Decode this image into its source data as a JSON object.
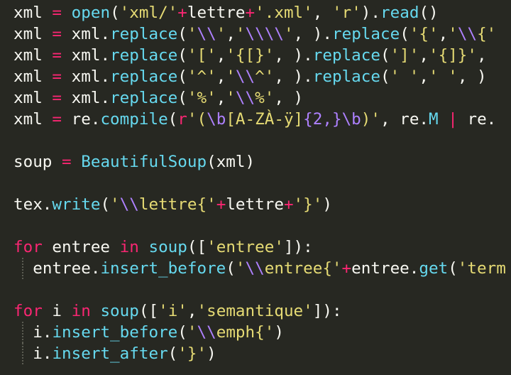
{
  "colors": {
    "background": "#272822",
    "plain": "#f8f8f2",
    "keyword": "#f92672",
    "builtin": "#66d9ef",
    "method": "#66d9ef",
    "string": "#e6db74",
    "escape": "#ae81ff",
    "indent_guide": "#5b5c52"
  },
  "lines": [
    {
      "indent": 0,
      "tokens": [
        {
          "t": "xml",
          "c": "plain"
        },
        {
          "t": " ",
          "c": "plain"
        },
        {
          "t": "=",
          "c": "keyword"
        },
        {
          "t": " ",
          "c": "plain"
        },
        {
          "t": "open",
          "c": "builtin"
        },
        {
          "t": "(",
          "c": "plain"
        },
        {
          "t": "'xml/'",
          "c": "string"
        },
        {
          "t": "+",
          "c": "keyword"
        },
        {
          "t": "lettre",
          "c": "plain"
        },
        {
          "t": "+",
          "c": "keyword"
        },
        {
          "t": "'.xml'",
          "c": "string"
        },
        {
          "t": ", ",
          "c": "plain"
        },
        {
          "t": "'r'",
          "c": "string"
        },
        {
          "t": ").",
          "c": "plain"
        },
        {
          "t": "read",
          "c": "method"
        },
        {
          "t": "()",
          "c": "plain"
        }
      ]
    },
    {
      "indent": 0,
      "tokens": [
        {
          "t": "xml",
          "c": "plain"
        },
        {
          "t": " ",
          "c": "plain"
        },
        {
          "t": "=",
          "c": "keyword"
        },
        {
          "t": " xml.",
          "c": "plain"
        },
        {
          "t": "replace",
          "c": "method"
        },
        {
          "t": "(",
          "c": "plain"
        },
        {
          "t": "'",
          "c": "string"
        },
        {
          "t": "\\\\",
          "c": "escape"
        },
        {
          "t": "'",
          "c": "string"
        },
        {
          "t": ",",
          "c": "plain"
        },
        {
          "t": "'",
          "c": "string"
        },
        {
          "t": "\\\\\\\\",
          "c": "escape"
        },
        {
          "t": "'",
          "c": "string"
        },
        {
          "t": ", ).",
          "c": "plain"
        },
        {
          "t": "replace",
          "c": "method"
        },
        {
          "t": "(",
          "c": "plain"
        },
        {
          "t": "'{'",
          "c": "string"
        },
        {
          "t": ",",
          "c": "plain"
        },
        {
          "t": "'",
          "c": "string"
        },
        {
          "t": "\\\\",
          "c": "escape"
        },
        {
          "t": "{'",
          "c": "string"
        }
      ]
    },
    {
      "indent": 0,
      "tokens": [
        {
          "t": "xml",
          "c": "plain"
        },
        {
          "t": " ",
          "c": "plain"
        },
        {
          "t": "=",
          "c": "keyword"
        },
        {
          "t": " xml.",
          "c": "plain"
        },
        {
          "t": "replace",
          "c": "method"
        },
        {
          "t": "(",
          "c": "plain"
        },
        {
          "t": "'['",
          "c": "string"
        },
        {
          "t": ",",
          "c": "plain"
        },
        {
          "t": "'{[}'",
          "c": "string"
        },
        {
          "t": ", ).",
          "c": "plain"
        },
        {
          "t": "replace",
          "c": "method"
        },
        {
          "t": "(",
          "c": "plain"
        },
        {
          "t": "']'",
          "c": "string"
        },
        {
          "t": ",",
          "c": "plain"
        },
        {
          "t": "'{]}'",
          "c": "string"
        },
        {
          "t": ", ",
          "c": "plain"
        }
      ]
    },
    {
      "indent": 0,
      "tokens": [
        {
          "t": "xml",
          "c": "plain"
        },
        {
          "t": " ",
          "c": "plain"
        },
        {
          "t": "=",
          "c": "keyword"
        },
        {
          "t": " xml.",
          "c": "plain"
        },
        {
          "t": "replace",
          "c": "method"
        },
        {
          "t": "(",
          "c": "plain"
        },
        {
          "t": "'^'",
          "c": "string"
        },
        {
          "t": ",",
          "c": "plain"
        },
        {
          "t": "'",
          "c": "string"
        },
        {
          "t": "\\\\",
          "c": "escape"
        },
        {
          "t": "^'",
          "c": "string"
        },
        {
          "t": ", ).",
          "c": "plain"
        },
        {
          "t": "replace",
          "c": "method"
        },
        {
          "t": "(",
          "c": "plain"
        },
        {
          "t": "' '",
          "c": "string"
        },
        {
          "t": ",",
          "c": "plain"
        },
        {
          "t": "' '",
          "c": "string"
        },
        {
          "t": ", )",
          "c": "plain"
        }
      ]
    },
    {
      "indent": 0,
      "tokens": [
        {
          "t": "xml",
          "c": "plain"
        },
        {
          "t": " ",
          "c": "plain"
        },
        {
          "t": "=",
          "c": "keyword"
        },
        {
          "t": " xml.",
          "c": "plain"
        },
        {
          "t": "replace",
          "c": "method"
        },
        {
          "t": "(",
          "c": "plain"
        },
        {
          "t": "'%'",
          "c": "string"
        },
        {
          "t": ",",
          "c": "plain"
        },
        {
          "t": "'",
          "c": "string"
        },
        {
          "t": "\\\\",
          "c": "escape"
        },
        {
          "t": "%'",
          "c": "string"
        },
        {
          "t": ", )",
          "c": "plain"
        }
      ]
    },
    {
      "indent": 0,
      "tokens": [
        {
          "t": "xml",
          "c": "plain"
        },
        {
          "t": " ",
          "c": "plain"
        },
        {
          "t": "=",
          "c": "keyword"
        },
        {
          "t": " re.",
          "c": "plain"
        },
        {
          "t": "compile",
          "c": "method"
        },
        {
          "t": "(",
          "c": "plain"
        },
        {
          "t": "r",
          "c": "keyword"
        },
        {
          "t": "'(",
          "c": "string"
        },
        {
          "t": "\\b",
          "c": "escape"
        },
        {
          "t": "[A-ZÀ-ÿ]",
          "c": "string"
        },
        {
          "t": "{2,}",
          "c": "escape"
        },
        {
          "t": "\\b",
          "c": "escape"
        },
        {
          "t": ")'",
          "c": "string"
        },
        {
          "t": ", re.",
          "c": "plain"
        },
        {
          "t": "M",
          "c": "builtin"
        },
        {
          "t": " ",
          "c": "plain"
        },
        {
          "t": "|",
          "c": "keyword"
        },
        {
          "t": " re.",
          "c": "plain"
        }
      ]
    },
    {
      "indent": 0,
      "tokens": []
    },
    {
      "indent": 0,
      "tokens": [
        {
          "t": "soup",
          "c": "plain"
        },
        {
          "t": " ",
          "c": "plain"
        },
        {
          "t": "=",
          "c": "keyword"
        },
        {
          "t": " ",
          "c": "plain"
        },
        {
          "t": "BeautifulSoup",
          "c": "method"
        },
        {
          "t": "(xml)",
          "c": "plain"
        }
      ]
    },
    {
      "indent": 0,
      "tokens": []
    },
    {
      "indent": 0,
      "tokens": [
        {
          "t": "tex.",
          "c": "plain"
        },
        {
          "t": "write",
          "c": "method"
        },
        {
          "t": "(",
          "c": "plain"
        },
        {
          "t": "'",
          "c": "string"
        },
        {
          "t": "\\\\",
          "c": "escape"
        },
        {
          "t": "lettre{'",
          "c": "string"
        },
        {
          "t": "+",
          "c": "keyword"
        },
        {
          "t": "lettre",
          "c": "plain"
        },
        {
          "t": "+",
          "c": "keyword"
        },
        {
          "t": "'}'",
          "c": "string"
        },
        {
          "t": ")",
          "c": "plain"
        }
      ]
    },
    {
      "indent": 0,
      "tokens": []
    },
    {
      "indent": 0,
      "tokens": [
        {
          "t": "for",
          "c": "keyword"
        },
        {
          "t": " entree ",
          "c": "plain"
        },
        {
          "t": "in",
          "c": "keyword"
        },
        {
          "t": " ",
          "c": "plain"
        },
        {
          "t": "soup",
          "c": "method"
        },
        {
          "t": "([",
          "c": "plain"
        },
        {
          "t": "'entree'",
          "c": "string"
        },
        {
          "t": "]):",
          "c": "plain"
        }
      ]
    },
    {
      "indent": 1,
      "tokens": [
        {
          "t": "  ",
          "c": "plain"
        },
        {
          "t": "entree.",
          "c": "plain"
        },
        {
          "t": "insert_before",
          "c": "method"
        },
        {
          "t": "(",
          "c": "plain"
        },
        {
          "t": "'",
          "c": "string"
        },
        {
          "t": "\\\\",
          "c": "escape"
        },
        {
          "t": "entree{'",
          "c": "string"
        },
        {
          "t": "+",
          "c": "keyword"
        },
        {
          "t": "entree.",
          "c": "plain"
        },
        {
          "t": "get",
          "c": "method"
        },
        {
          "t": "(",
          "c": "plain"
        },
        {
          "t": "'term",
          "c": "string"
        }
      ]
    },
    {
      "indent": 0,
      "tokens": []
    },
    {
      "indent": 0,
      "tokens": [
        {
          "t": "for",
          "c": "keyword"
        },
        {
          "t": " i ",
          "c": "plain"
        },
        {
          "t": "in",
          "c": "keyword"
        },
        {
          "t": " ",
          "c": "plain"
        },
        {
          "t": "soup",
          "c": "method"
        },
        {
          "t": "([",
          "c": "plain"
        },
        {
          "t": "'i'",
          "c": "string"
        },
        {
          "t": ",",
          "c": "plain"
        },
        {
          "t": "'semantique'",
          "c": "string"
        },
        {
          "t": "]):",
          "c": "plain"
        }
      ]
    },
    {
      "indent": 1,
      "tokens": [
        {
          "t": "  ",
          "c": "plain"
        },
        {
          "t": "i.",
          "c": "plain"
        },
        {
          "t": "insert_before",
          "c": "method"
        },
        {
          "t": "(",
          "c": "plain"
        },
        {
          "t": "'",
          "c": "string"
        },
        {
          "t": "\\\\",
          "c": "escape"
        },
        {
          "t": "emph{'",
          "c": "string"
        },
        {
          "t": ")",
          "c": "plain"
        }
      ]
    },
    {
      "indent": 1,
      "tokens": [
        {
          "t": "  ",
          "c": "plain"
        },
        {
          "t": "i.",
          "c": "plain"
        },
        {
          "t": "insert_after",
          "c": "method"
        },
        {
          "t": "(",
          "c": "plain"
        },
        {
          "t": "'}'",
          "c": "string"
        },
        {
          "t": ")",
          "c": "plain"
        }
      ]
    }
  ]
}
